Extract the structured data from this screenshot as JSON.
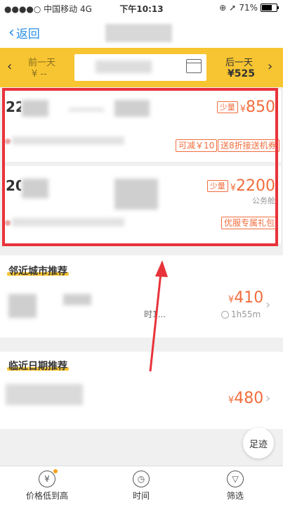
{
  "status_bar": {
    "carrier": "●●●●○ 中国移动  4G",
    "time": "下午10:13",
    "battery": "71%"
  },
  "nav": {
    "back_label": "返回"
  },
  "date_bar": {
    "prev_label": "前一天",
    "prev_price": "¥ --",
    "next_label": "后一天",
    "next_price": "¥525"
  },
  "flights": [
    {
      "time_partial": "22:1",
      "badge": "少量",
      "currency": "¥",
      "price": "850",
      "cabin": "",
      "promos": [
        "可减￥10",
        "送8折接送机券"
      ]
    },
    {
      "time_partial": "20:0",
      "badge": "少量",
      "currency": "¥",
      "price": "2200",
      "cabin": "公务舱",
      "promos": [
        "优服专属礼包"
      ]
    }
  ],
  "nearby_city": {
    "title": "邻近城市推荐",
    "currency": "¥",
    "price": "410",
    "duration": "1h55m",
    "partial_text": "时1..."
  },
  "nearby_date": {
    "title": "临近日期推荐",
    "currency": "¥",
    "price": "480"
  },
  "floating": {
    "footprint_label": "足迹"
  },
  "tab_bar": {
    "tabs": [
      {
        "label": "价格低到高",
        "icon": "yuan-icon"
      },
      {
        "label": "时间",
        "icon": "clock-icon"
      },
      {
        "label": "筛选",
        "icon": "filter-icon"
      }
    ]
  },
  "colors": {
    "accent": "#f26d3d",
    "header_yellow": "#f7c531",
    "highlight_red": "#e8333a",
    "link_blue": "#2a8ee8"
  }
}
